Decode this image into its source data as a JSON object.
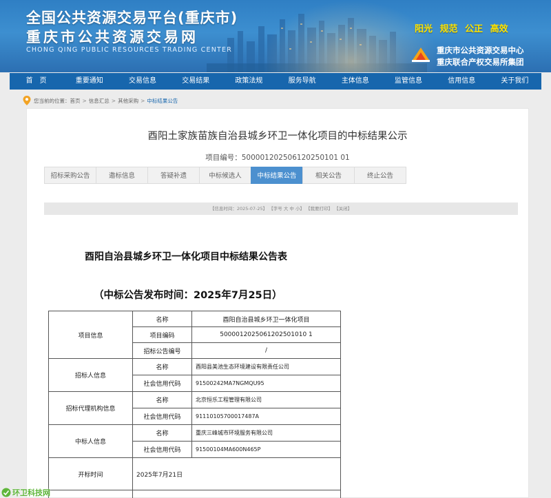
{
  "header": {
    "title_line1": "全国公共资源交易平台(重庆市)",
    "title_line2": "重庆市公共资源交易网",
    "title_en": "CHONG QING PUBLIC RESOURCES TRADING CENTER",
    "slogan": "阳光 规范 公正 高效",
    "org_line1": "重庆市公共资源交易中心",
    "org_line2": "重庆联合产权交易所集团",
    "colors": {
      "banner": "#2f7fc4",
      "slogan": "#ffe400",
      "nav": "#1766ad",
      "active_tab": "#4c90cf"
    }
  },
  "nav": {
    "items": [
      {
        "label": "首　页"
      },
      {
        "label": "重要通知"
      },
      {
        "label": "交易信息"
      },
      {
        "label": "交易结果"
      },
      {
        "label": "政策法规"
      },
      {
        "label": "服务导航"
      },
      {
        "label": "主体信息"
      },
      {
        "label": "监管信息"
      },
      {
        "label": "信用信息"
      },
      {
        "label": "关于我们"
      }
    ]
  },
  "breadcrumb": {
    "prefix": "您当前的位置：",
    "items": [
      "首页",
      "信息汇总",
      "其他采购",
      "中标结果公告"
    ]
  },
  "article": {
    "title": "酉阳土家族苗族自治县城乡环卫一体化项目的中标结果公示",
    "project_no": "项目编号：500001202506120250101 01",
    "tabs": [
      {
        "label": "招标采购公告"
      },
      {
        "label": "邀标信息"
      },
      {
        "label": "答疑补遗"
      },
      {
        "label": "中标候选人"
      },
      {
        "label": "中标结果公告",
        "active": true
      },
      {
        "label": "相关公告"
      },
      {
        "label": "终止公告"
      }
    ],
    "info_bar": {
      "publish": "【信息时间：2025-07-25】",
      "font_size": "【字号 大 中 小】",
      "collect": "【我要打印】",
      "close": "【关闭】"
    },
    "heading": "酉阳自治县城乡环卫一体化项目中标结果公告表",
    "subheading": "（中标公告发布时间：2025年7月25日）"
  },
  "table": {
    "groups": [
      {
        "label": "项目信息",
        "rows": [
          {
            "field": "名称",
            "value": "酉阳自治县城乡环卫一体化项目"
          },
          {
            "field": "项目编码",
            "value": "5000012025061202501010 1"
          },
          {
            "field": "招标公告编号",
            "value": "/"
          }
        ]
      },
      {
        "label": "招标人信息",
        "rows": [
          {
            "field": "名称",
            "value": "酉阳县美池生态环境建设有限责任公司"
          },
          {
            "field": "社会信用代码",
            "value": "91500242MA7NGMQU95"
          }
        ]
      },
      {
        "label": "招标代理机构信息",
        "rows": [
          {
            "field": "名称",
            "value": "北京恒乐工程管理有限公司"
          },
          {
            "field": "社会信用代码",
            "value": "91110105700017487A"
          }
        ]
      },
      {
        "label": "中标人信息",
        "rows": [
          {
            "field": "名称",
            "value": "重庆三峰城市环境服务有限公司"
          },
          {
            "field": "社会信用代码",
            "value": "91500104MA600N465P"
          }
        ]
      },
      {
        "label": "开标时间",
        "rows": [
          {
            "field": "2025年7月21日",
            "value": ""
          }
        ]
      }
    ]
  },
  "watermark": {
    "text": "环卫科技网"
  }
}
